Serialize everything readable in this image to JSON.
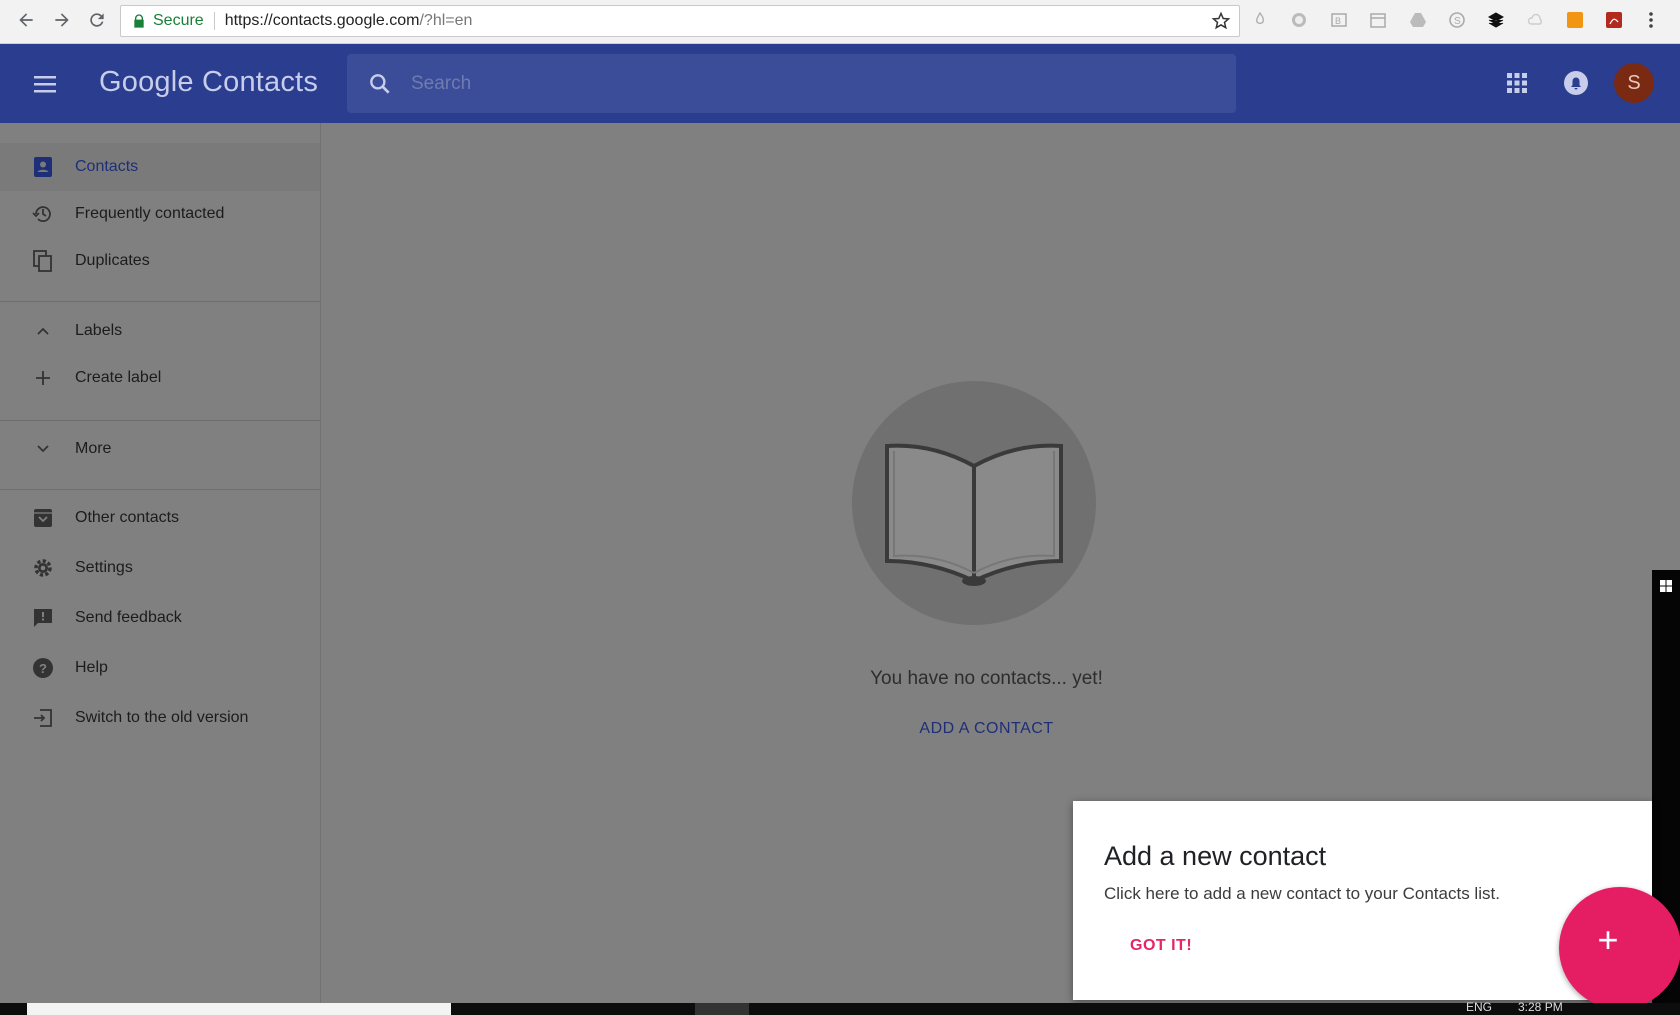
{
  "browser": {
    "secure_label": "Secure",
    "url_host": "https://contacts.google.com",
    "url_rest": "/?hl=en"
  },
  "header": {
    "brand": "Google Contacts",
    "search_placeholder": "Search",
    "avatar_letter": "S"
  },
  "sidebar": {
    "items": [
      {
        "label": "Contacts",
        "icon": "contacts-icon",
        "active": true
      },
      {
        "label": "Frequently contacted",
        "icon": "history-icon"
      },
      {
        "label": "Duplicates",
        "icon": "copy-icon"
      },
      {
        "label": "Labels",
        "icon": "chevron-up-icon"
      },
      {
        "label": "Create label",
        "icon": "plus-icon"
      },
      {
        "label": "More",
        "icon": "chevron-down-icon"
      },
      {
        "label": "Other contacts",
        "icon": "archive-icon"
      },
      {
        "label": "Settings",
        "icon": "gear-icon"
      },
      {
        "label": "Send feedback",
        "icon": "feedback-icon"
      },
      {
        "label": "Help",
        "icon": "help-icon"
      },
      {
        "label": "Switch to the old version",
        "icon": "exit-icon"
      }
    ]
  },
  "main": {
    "empty_message": "You have no contacts... yet!",
    "add_contact_label": "ADD A CONTACT"
  },
  "card": {
    "title": "Add a new contact",
    "body": "Click here to add a new contact to your Contacts list.",
    "button": "GOT IT!"
  },
  "fab": {
    "symbol": "+"
  },
  "taskbar": {
    "lang": "ENG",
    "time": "3:28 PM"
  },
  "colors": {
    "appbar": "#2a3d8f",
    "overlay_gray": "#808080",
    "accent_pink": "#e51e64",
    "link_blue": "#1e2f78"
  }
}
